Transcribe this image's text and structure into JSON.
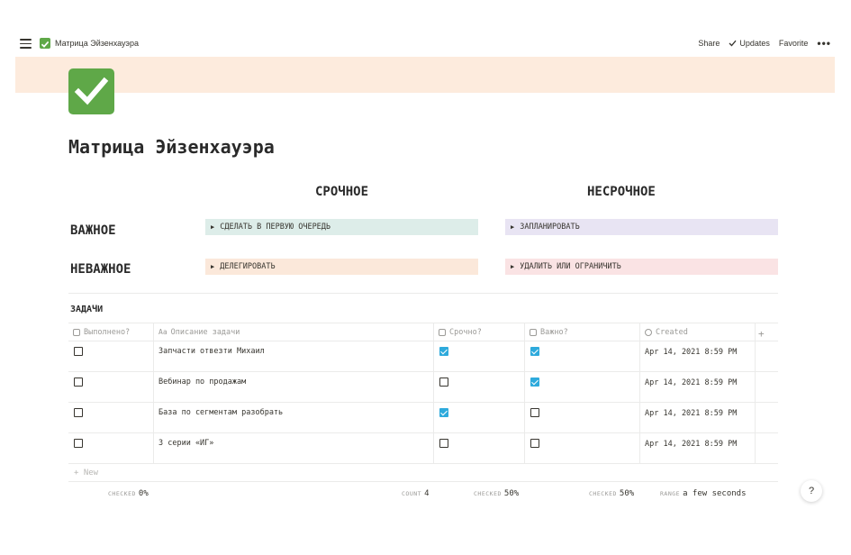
{
  "topbar": {
    "title": "Матрица Эйзенхауэра",
    "share": "Share",
    "updates": "Updates",
    "favorite": "Favorite",
    "more": "•••"
  },
  "colors": {
    "cover": "#fdebdd",
    "icon": "#5fa848",
    "check_blue": "#2eaadc"
  },
  "page": {
    "title": "Матрица Эйзенхауэра"
  },
  "matrix": {
    "columns": [
      "СРОЧНОЕ",
      "НЕСРОЧНОЕ"
    ],
    "rows": [
      "ВАЖНОЕ",
      "НЕВАЖНОЕ"
    ],
    "cells": [
      "СДЕЛАТЬ В ПЕРВУЮ ОЧЕРЕДЬ",
      "ЗАПЛАНИРОВАТЬ",
      "ДЕЛЕГИРОВАТЬ",
      "УДАЛИТЬ ИЛИ ОГРАНИЧИТЬ"
    ]
  },
  "database": {
    "title": "ЗАДАЧИ",
    "headers": [
      "Выполнено?",
      "Описание задачи",
      "Срочно?",
      "Важно?",
      "Created",
      "+"
    ],
    "rows": [
      {
        "done": false,
        "desc": "Запчасти отвезти Михаил",
        "urgent": true,
        "important": true,
        "created": "Apr 14, 2021 8:59 PM"
      },
      {
        "done": false,
        "desc": "Вебинар по продажам",
        "urgent": false,
        "important": true,
        "created": "Apr 14, 2021 8:59 PM"
      },
      {
        "done": false,
        "desc": "База по сегментам разобрать",
        "urgent": true,
        "important": false,
        "created": "Apr 14, 2021 8:59 PM"
      },
      {
        "done": false,
        "desc": "3 серии «ИГ»",
        "urgent": false,
        "important": false,
        "created": "Apr 14, 2021 8:59 PM"
      }
    ],
    "new_label": "+ New",
    "calc": [
      {
        "key": "CHECKED",
        "value": "0%"
      },
      {
        "key": "COUNT",
        "value": "4"
      },
      {
        "key": "CHECKED",
        "value": "50%"
      },
      {
        "key": "CHECKED",
        "value": "50%"
      },
      {
        "key": "RANGE",
        "value": "a few seconds"
      }
    ]
  },
  "help": "?"
}
